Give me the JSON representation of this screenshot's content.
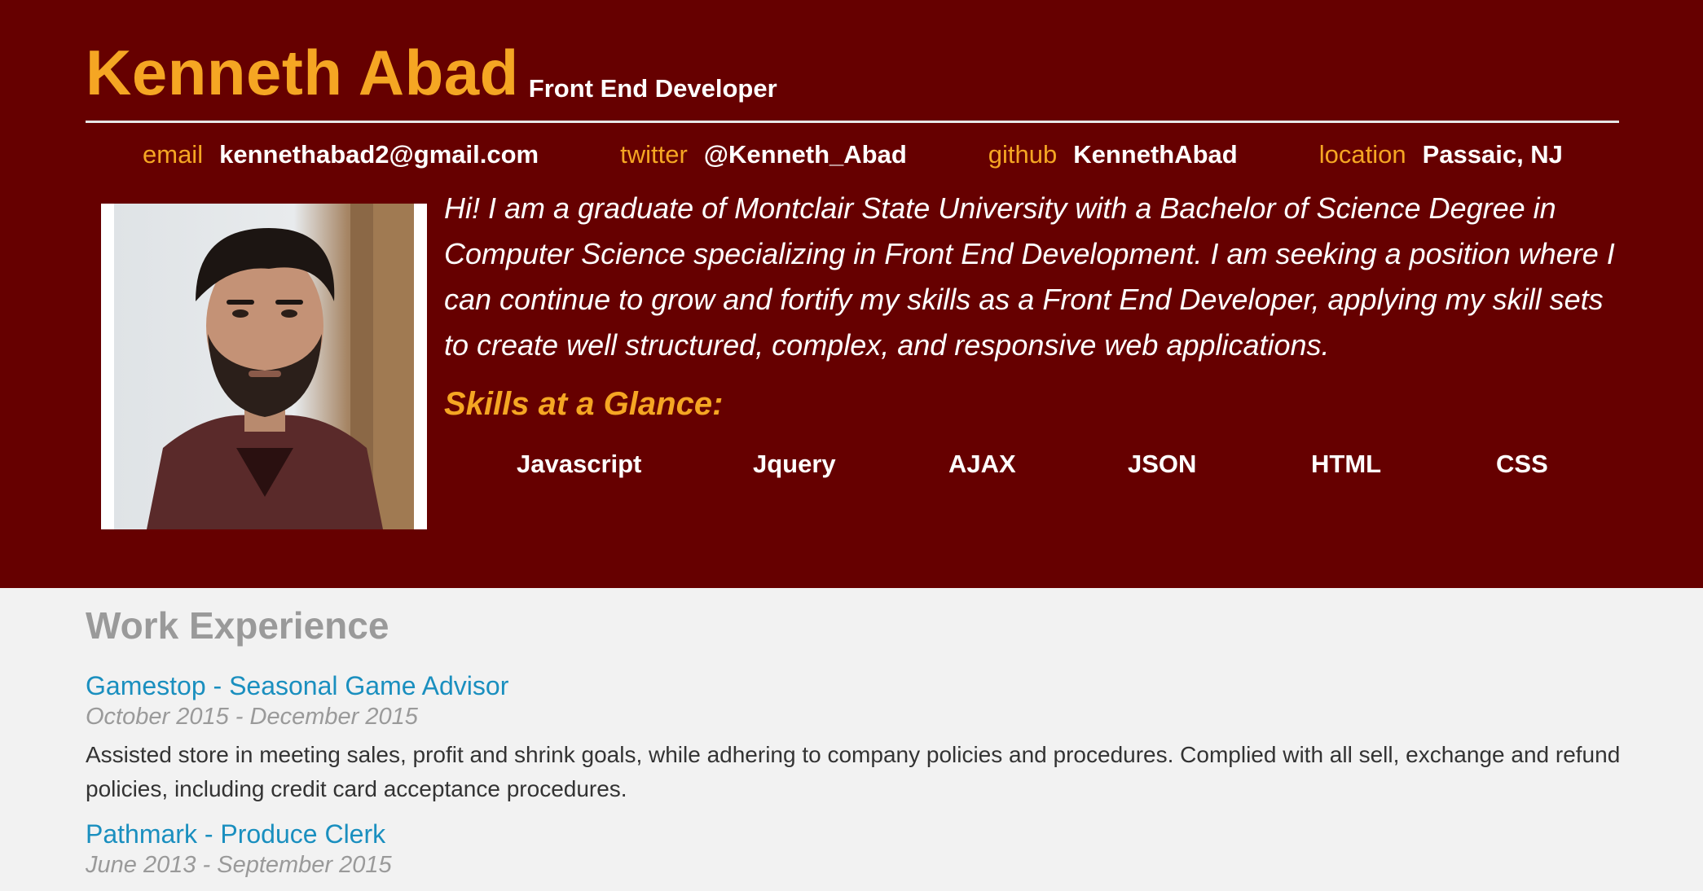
{
  "header": {
    "name": "Kenneth Abad",
    "role": "Front End Developer"
  },
  "contact": {
    "items": [
      {
        "label": "email",
        "value": "kennethabad2@gmail.com"
      },
      {
        "label": "twitter",
        "value": "@Kenneth_Abad"
      },
      {
        "label": "github",
        "value": "KennethAbad"
      },
      {
        "label": "location",
        "value": "Passaic, NJ"
      }
    ]
  },
  "profile": {
    "bio": "Hi! I am a graduate of Montclair State University with a Bachelor of Science Degree in Computer Science specializing in Front End Development. I am seeking a position where I can continue to grow and fortify my skills as a Front End Developer, applying my skill sets to create well structured, complex, and responsive web applications."
  },
  "skills": {
    "heading": "Skills at a Glance:",
    "items": [
      "Javascript",
      "Jquery",
      "AJAX",
      "JSON",
      "HTML",
      "CSS"
    ]
  },
  "work": {
    "heading": "Work Experience",
    "jobs": [
      {
        "title": "Gamestop - Seasonal Game Advisor",
        "dates": "October 2015 - December 2015",
        "description": "Assisted store in meeting sales, profit and shrink goals, while adhering to company policies and procedures. Complied with all sell, exchange and refund policies, including credit card acceptance procedures."
      },
      {
        "title": "Pathmark - Produce Clerk",
        "dates": "June 2013 - September 2015"
      }
    ]
  },
  "colors": {
    "hero_bg": "#660000",
    "accent": "#f5a623",
    "link": "#1a8fbf",
    "muted": "#9a9a9a",
    "page_bg": "#f2f2f2"
  }
}
